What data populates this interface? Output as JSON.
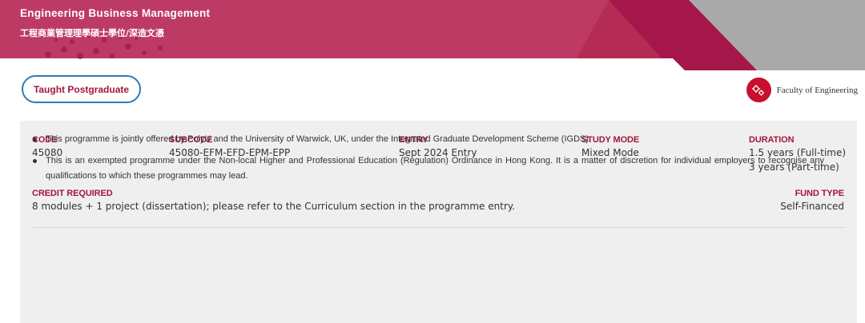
{
  "banner": {
    "title": "Engineering Business Management",
    "subtitle": "工程商業管理理學碩士學位/深造文憑",
    "colors": {
      "primary": "#b42b55",
      "dark": "#a5174a",
      "grey": "#a9a9a9"
    }
  },
  "programme_type": "Taught Postgraduate",
  "faculty": {
    "label": "Faculty of Engineering",
    "icon": "gears-icon"
  },
  "details": {
    "code": {
      "label": "CODE",
      "value": "45080"
    },
    "subcode": {
      "label": "SUBCODE",
      "value": "45080-EFM-EFD-EPM-EPP"
    },
    "entry": {
      "label": "ENTRY",
      "value": "Sept 2024 Entry"
    },
    "study_mode": {
      "label": "STUDY MODE",
      "value": "Mixed Mode"
    },
    "duration": {
      "label": "DURATION",
      "value_1": "1.5 years (Full-time)",
      "value_2": "3 years (Part-time)"
    },
    "credit": {
      "label": "CREDIT REQUIRED",
      "value": "8 modules + 1 project (dissertation); please refer to the Curriculum section in the programme entry."
    },
    "fund_type": {
      "label": "FUND TYPE",
      "value": "Self-Financed"
    }
  },
  "notes": [
    "This programme is jointly offered by PolyU and the University of Warwick, UK, under the Integrated Graduate Development Scheme (IGDS).",
    "This is an exempted programme under the Non-local Higher and Professional Education (Regulation) Ordinance in Hong Kong. It is a matter of discretion for individual employers to recognise any qualifications to which these programmes may lead."
  ]
}
